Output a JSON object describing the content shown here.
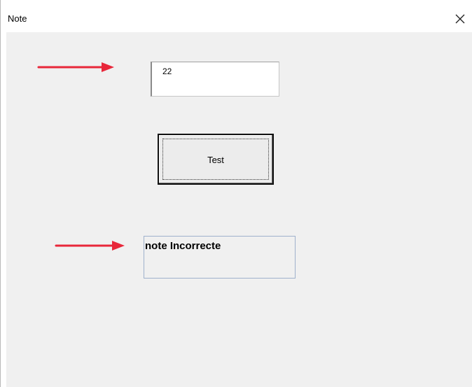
{
  "window": {
    "title": "Note",
    "close_icon": "close-icon"
  },
  "form": {
    "input_value": "22",
    "test_button_label": "Test",
    "result_label": "note Incorrecte"
  },
  "annotations": {
    "arrow_color": "#e8273a"
  },
  "colors": {
    "client_background": "#f0f0f0",
    "result_border": "#9fb1cc"
  }
}
